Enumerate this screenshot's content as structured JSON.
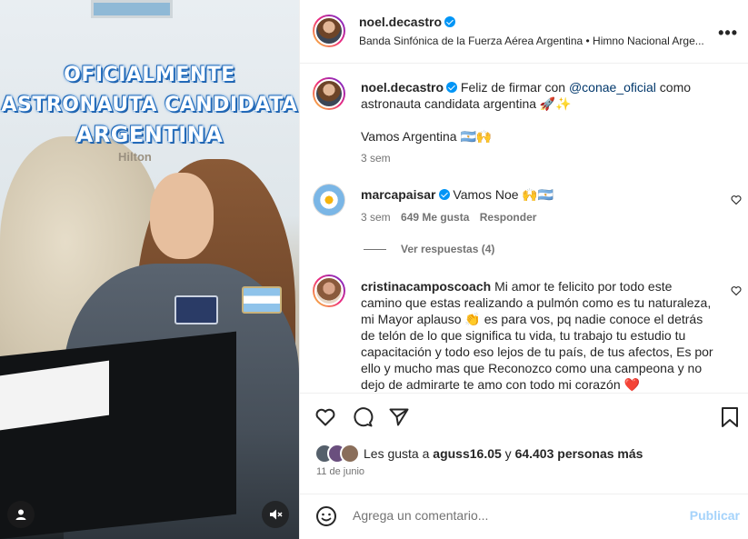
{
  "media": {
    "overlay_line1": "OFICIALMENTE",
    "overlay_line2": "ASTRONAUTA CANDIDATA",
    "overlay_line3": "ARGENTINA",
    "bg_sign": "Hilton",
    "user_icon": "user-icon",
    "mute_icon": "muted-speaker-icon"
  },
  "header": {
    "username": "noel.decastro",
    "audio": "Banda Sinfónica de la Fuerza Aérea Argentina • Himno Nacional Arge...",
    "more": "•••"
  },
  "caption": {
    "username": "noel.decastro",
    "text_before": "Feliz de firmar con ",
    "mention": "@conae_oficial",
    "text_after": " como astronauta candidata argentina 🚀✨",
    "line2": "Vamos Argentina 🇦🇷🙌",
    "time": "3 sem"
  },
  "comment1": {
    "username": "marcapaisar",
    "text": "Vamos Noe 🙌🇦🇷",
    "time": "3 sem",
    "likes": "649 Me gusta",
    "reply": "Responder",
    "view_replies": "Ver respuestas (4)"
  },
  "comment2": {
    "username": "cristinacamposcoach",
    "text": "Mi amor te felicito por todo este camino que estas realizando a pulmón como es tu naturaleza, mi Mayor aplauso 👏 es para vos, pq nadie conoce el detrás de telón de lo que significa tu vida, tu trabajo tu estudio tu capacitación y todo eso lejos de tu país, de tus afectos, Es por ello y mucho mas que Reconozco como una campeona y no dejo de admirarte te amo con todo mi corazón ❤️"
  },
  "likes": {
    "prefix": "Les gusta a ",
    "user": "aguss16.05",
    "middle": " y ",
    "count": "64.403 personas más",
    "date": "11 de junio"
  },
  "add_comment": {
    "placeholder": "Agrega un comentario...",
    "publish": "Publicar"
  },
  "colors": {
    "verified": "#0095f6",
    "publish_disabled": "#a5d3fb",
    "mention": "#00376b"
  }
}
